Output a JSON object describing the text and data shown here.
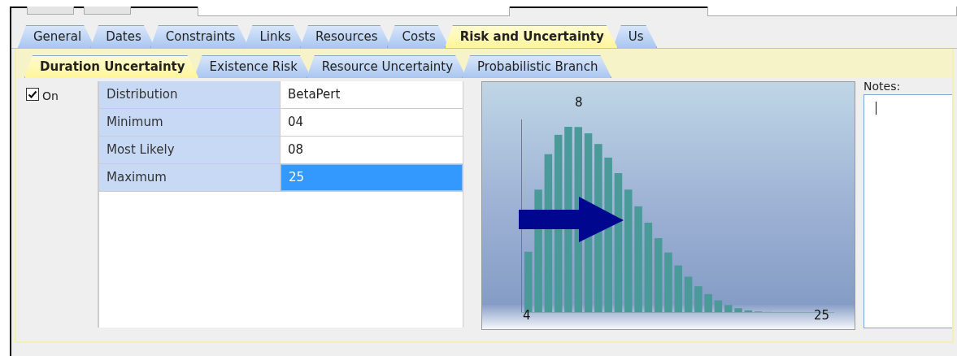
{
  "main_tabs": [
    {
      "label": "General",
      "selected": false
    },
    {
      "label": "Dates",
      "selected": false
    },
    {
      "label": "Constraints",
      "selected": false
    },
    {
      "label": "Links",
      "selected": false
    },
    {
      "label": "Resources",
      "selected": false
    },
    {
      "label": "Costs",
      "selected": false
    },
    {
      "label": "Risk and Uncertainty",
      "selected": true
    },
    {
      "label": "Us",
      "selected": false
    }
  ],
  "sub_tabs": [
    {
      "label": "Duration Uncertainty",
      "selected": true
    },
    {
      "label": "Existence Risk",
      "selected": false
    },
    {
      "label": "Resource Uncertainty",
      "selected": false
    },
    {
      "label": "Probabilistic Branch",
      "selected": false
    }
  ],
  "enabled": {
    "label": "On",
    "checked": true
  },
  "properties": [
    {
      "name": "Distribution",
      "value": "BetaPert",
      "selected": false
    },
    {
      "name": "Minimum",
      "value": "04",
      "selected": false
    },
    {
      "name": "Most Likely",
      "value": "08",
      "selected": false
    },
    {
      "name": "Maximum",
      "value": "25",
      "selected": true
    }
  ],
  "distribution_chart": {
    "mode_label": "8",
    "min_label": "4",
    "max_label": "25"
  },
  "notes": {
    "label": "Notes:"
  }
}
